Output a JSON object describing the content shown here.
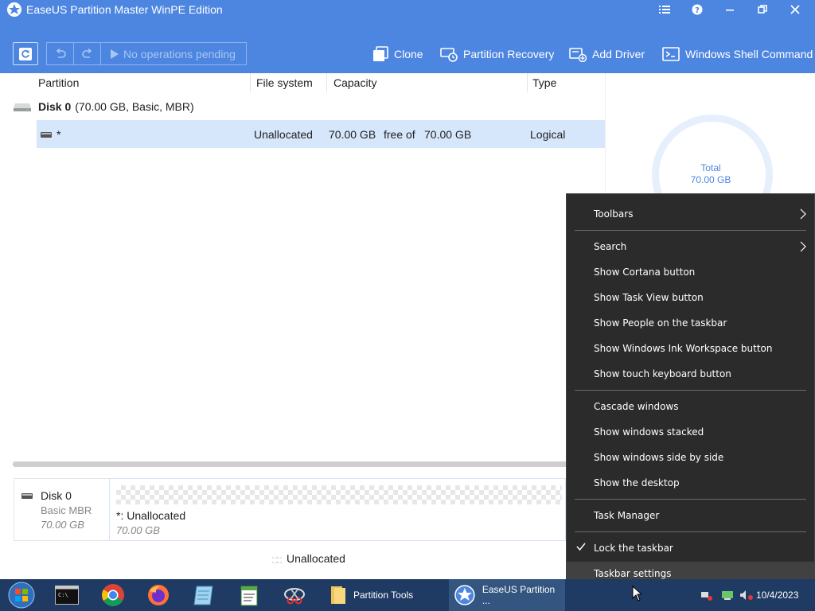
{
  "window": {
    "title": "EaseUS Partition Master WinPE Edition"
  },
  "toolbar": {
    "pending_label": "No operations pending",
    "clone_label": "Clone",
    "partition_recovery_label": "Partition Recovery",
    "add_driver_label": "Add Driver",
    "shell_command_label": "Windows Shell Command"
  },
  "table": {
    "headers": {
      "partition": "Partition",
      "file_system": "File system",
      "capacity": "Capacity",
      "type": "Type"
    },
    "disk": {
      "name": "Disk 0",
      "details": "(70.00 GB, Basic, MBR)"
    },
    "row": {
      "partition": "*",
      "file_system": "Unallocated",
      "capacity": "70.00 GB",
      "free_of": "free of",
      "total": "70.00 GB",
      "type": "Logical"
    }
  },
  "side": {
    "total_label": "Total",
    "total_value": "70.00 GB"
  },
  "disk_map": {
    "disk_name": "Disk 0",
    "disk_type": "Basic MBR",
    "disk_size": "70.00 GB",
    "part_label": "*: Unallocated",
    "part_size": "70.00 GB",
    "legend": "Unallocated"
  },
  "context_menu": {
    "items": [
      {
        "label": "Toolbars"
      },
      {
        "label": "Search"
      },
      {
        "label": "Show Cortana button"
      },
      {
        "label": "Show Task View button"
      },
      {
        "label": "Show People on the taskbar"
      },
      {
        "label": "Show Windows Ink Workspace button"
      },
      {
        "label": "Show touch keyboard button"
      },
      {
        "label": "Cascade windows"
      },
      {
        "label": "Show windows stacked"
      },
      {
        "label": "Show windows side by side"
      },
      {
        "label": "Show the desktop"
      },
      {
        "label": "Task Manager"
      },
      {
        "label": "Lock the taskbar"
      },
      {
        "label": "Taskbar settings"
      }
    ]
  },
  "taskbar": {
    "partition_tools_label": "Partition Tools",
    "easeus_label": "EaseUS Partition ...",
    "date": "10/4/2023"
  },
  "colors": {
    "accent": "#4d86e0",
    "selected_row": "#d6e6fb",
    "menu_bg": "#2b2b2b",
    "taskbar": "#1f3a63"
  }
}
